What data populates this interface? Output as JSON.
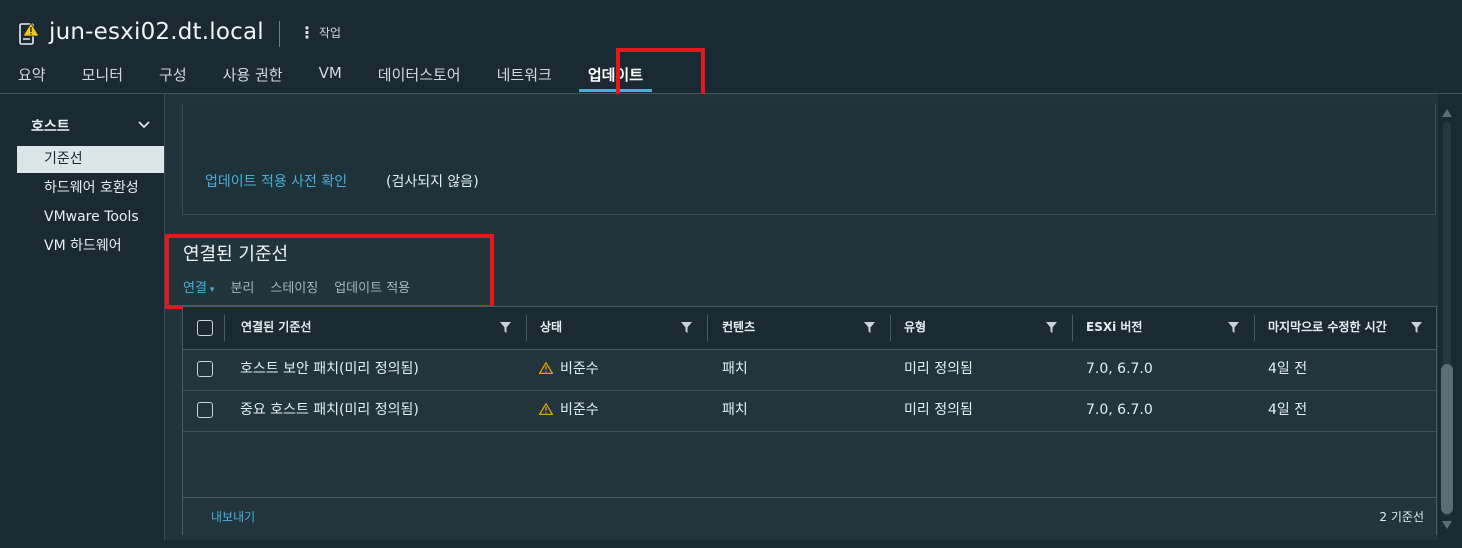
{
  "header": {
    "host_name": "jun-esxi02.dt.local",
    "actions_label": "작업",
    "host_icon": "host-warning-icon"
  },
  "tabs": [
    {
      "label": "요약"
    },
    {
      "label": "모니터"
    },
    {
      "label": "구성"
    },
    {
      "label": "사용 권한"
    },
    {
      "label": "VM"
    },
    {
      "label": "데이터스토어"
    },
    {
      "label": "네트워크"
    },
    {
      "label": "업데이트",
      "active": true
    }
  ],
  "sidebar": {
    "group_label": "호스트",
    "items": [
      {
        "label": "기준선",
        "active": true
      },
      {
        "label": "하드웨어 호환성"
      },
      {
        "label": "VMware Tools"
      },
      {
        "label": "VM 하드웨어"
      }
    ]
  },
  "precheck": {
    "link_label": "업데이트 적용 사전 확인",
    "status": "(검사되지 않음)"
  },
  "baselines": {
    "title": "연결된 기준선",
    "toolbar": {
      "attach": "연결",
      "detach": "분리",
      "stage": "스테이징",
      "remediate": "업데이트 적용"
    },
    "columns": [
      "연결된 기준선",
      "상태",
      "컨텐츠",
      "유형",
      "ESXi 버전",
      "마지막으로 수정한 시간"
    ],
    "rows": [
      {
        "name": "호스트 보안 패치(미리 정의됨)",
        "status": "비준수",
        "content": "패치",
        "type": "미리 정의됨",
        "esxi_version": "7.0, 6.7.0",
        "modified": "4일 전"
      },
      {
        "name": "중요 호스트 패치(미리 정의됨)",
        "status": "비준수",
        "content": "패치",
        "type": "미리 정의됨",
        "esxi_version": "7.0, 6.7.0",
        "modified": "4일 전"
      }
    ],
    "footer": {
      "export_label": "내보내기",
      "count_label": "2 기준선"
    }
  },
  "colors": {
    "accent": "#49afd9",
    "highlight_box": "#e8171d",
    "warning": "#e0a000",
    "background": "#1b2a32"
  }
}
